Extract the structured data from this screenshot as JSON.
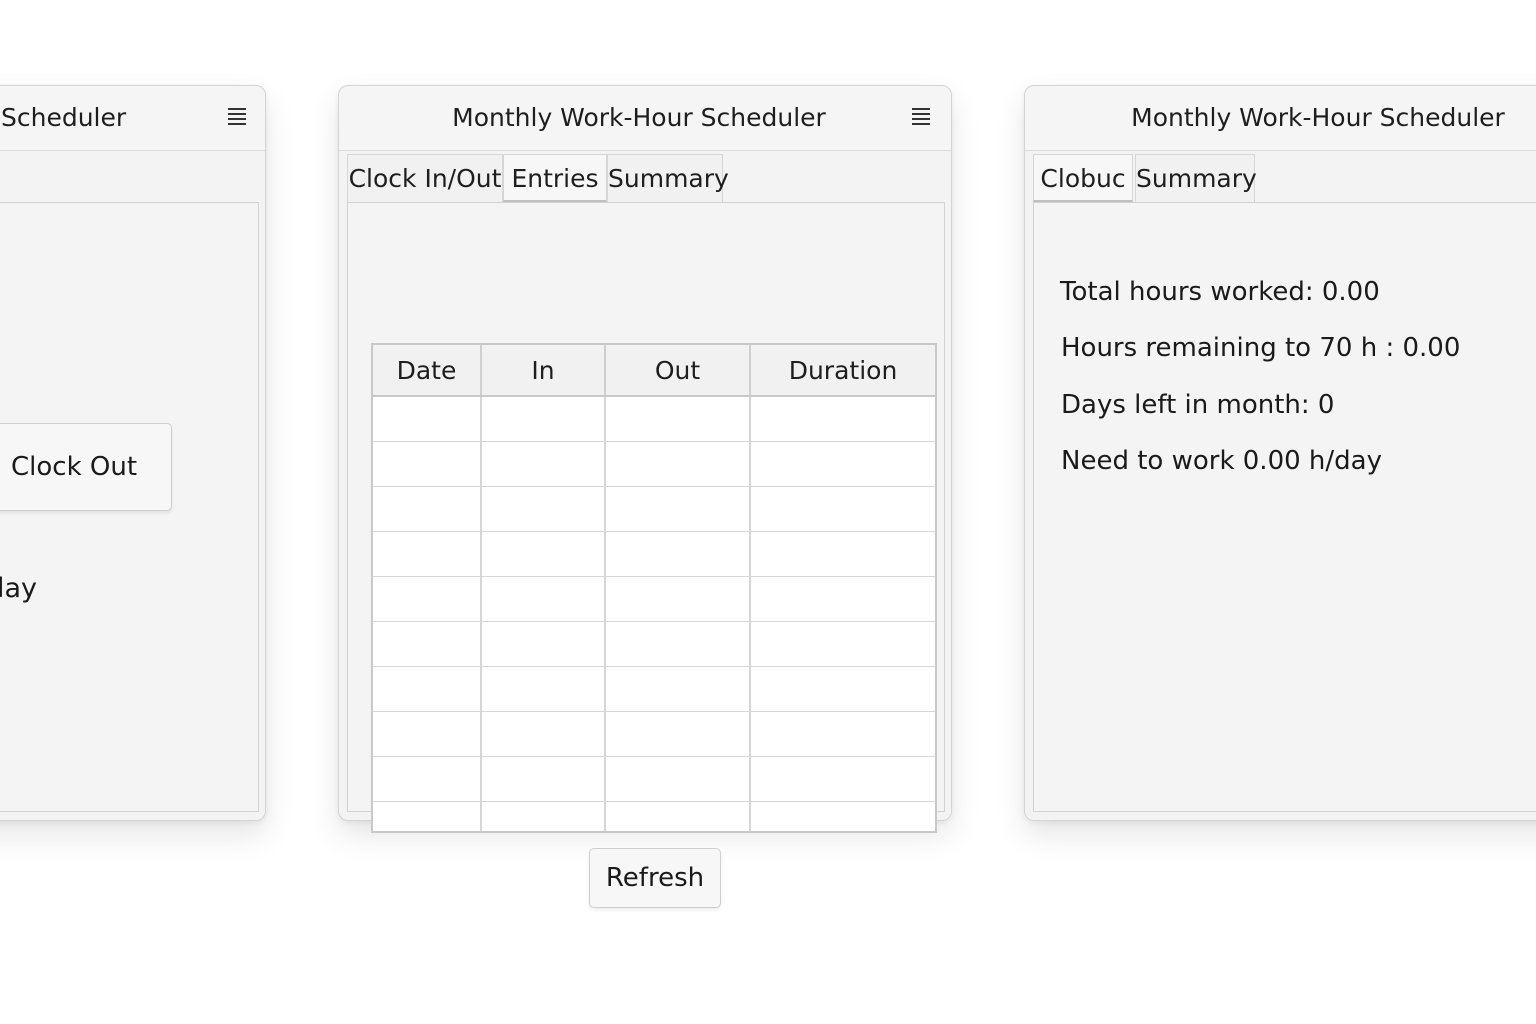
{
  "windows": {
    "left": {
      "title": "Scheduler",
      "clock_button_label": "Clock Out",
      "status_text": "ked in today"
    },
    "middle": {
      "title": "Monthly Work-Hour Scheduler",
      "tabs": [
        {
          "label": "Clock In/Out",
          "active": false
        },
        {
          "label": "Entries",
          "active": true
        },
        {
          "label": "Summary",
          "active": false
        }
      ],
      "table": {
        "columns": [
          "Date",
          "In",
          "Out",
          "Duration"
        ],
        "rows": [
          [
            "",
            "",
            "",
            ""
          ],
          [
            "",
            "",
            "",
            ""
          ],
          [
            "",
            "",
            "",
            ""
          ],
          [
            "",
            "",
            "",
            ""
          ],
          [
            "",
            "",
            "",
            ""
          ],
          [
            "",
            "",
            "",
            ""
          ],
          [
            "",
            "",
            "",
            ""
          ],
          [
            "",
            "",
            "",
            ""
          ],
          [
            "",
            "",
            "",
            ""
          ],
          [
            "",
            "",
            "",
            ""
          ]
        ]
      },
      "refresh_label": "Refresh"
    },
    "right": {
      "title": "Monthly Work-Hour Scheduler",
      "tabs": [
        {
          "label": "Clobuc",
          "active": true
        },
        {
          "label": "Summary",
          "active": false
        }
      ],
      "summary": {
        "total_hours": "Total hours worked: 0.00",
        "hours_remaining": "Hours remaining to 70 h :  0.00",
        "days_left": "Days left in month:  0",
        "need_per_day": "Need to work 0.00 h/day"
      }
    }
  },
  "icons": {
    "menu": "hamburger-menu-icon"
  }
}
